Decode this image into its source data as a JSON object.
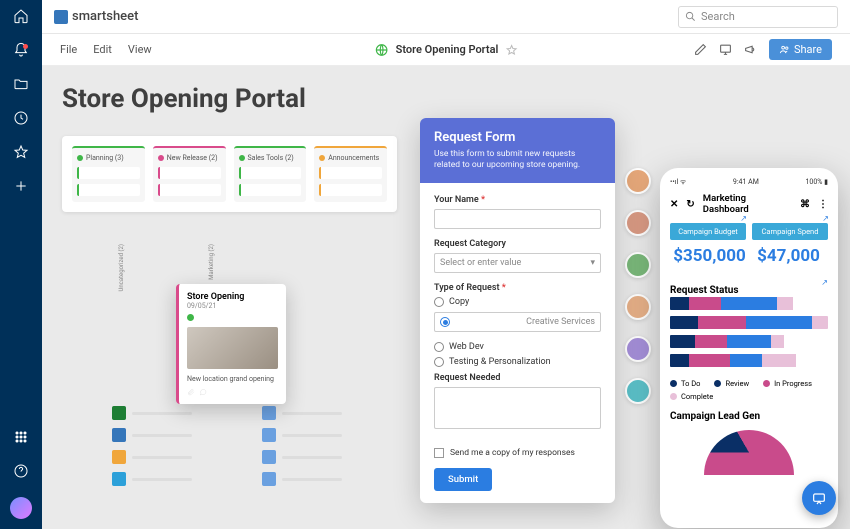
{
  "brand": "smartsheet",
  "search": {
    "placeholder": "Search"
  },
  "menu": {
    "file": "File",
    "edit": "Edit",
    "view": "View"
  },
  "page": {
    "title": "Store Opening Portal",
    "share": "Share"
  },
  "h1": "Store Opening Portal",
  "kanban": [
    {
      "label": "Planning (3)",
      "dot": "#3fb648",
      "bar": "#3fb648"
    },
    {
      "label": "New Release (2)",
      "dot": "#d94b8b",
      "bar": "#d94b8b"
    },
    {
      "label": "Sales Tools (2)",
      "dot": "#3fb648",
      "bar": "#3fb648"
    },
    {
      "label": "Announcements",
      "dot": "#f0a63b",
      "bar": "#f0a63b"
    }
  ],
  "swim_labels": {
    "left": "Uncategorized (2)",
    "right": "Marketing (2)"
  },
  "card": {
    "title": "Store Opening",
    "date": "09/05/21",
    "desc": "New location grand opening"
  },
  "files_left": [
    "#1e7e34",
    "#3576ba",
    "#f0a63b",
    "#2ca0d9"
  ],
  "files_right": [
    "#6aa0e0",
    "#6aa0e0",
    "#6aa0e0",
    "#6aa0e0"
  ],
  "form": {
    "title": "Request Form",
    "sub": "Use this form to submit new requests related to our upcoming store opening.",
    "name": "Your Name",
    "cat": "Request Category",
    "cat_ph": "Select or enter value",
    "type": "Type of Request",
    "opts": [
      "Copy",
      "Creative Services",
      "Web Dev",
      "Testing & Personalization"
    ],
    "opt_sel": 1,
    "needed": "Request Needed",
    "chk": "Send me a copy of my responses",
    "submit": "Submit"
  },
  "people": [
    "#e6a87a",
    "#d99a84",
    "#7ab87a",
    "#e6b088",
    "#a58fd9",
    "#5cc1c9"
  ],
  "phone": {
    "time": "9:41 AM",
    "batt": "100%",
    "title": "Marketing Dashboard",
    "chip1": "Campaign Budget",
    "chip2": "Campaign Spend",
    "m1": "$350,000",
    "m2": "$47,000",
    "sec1": "Request Status",
    "legend": [
      {
        "l": "To Do",
        "c": "#0a2f66"
      },
      {
        "l": "Review",
        "c": "#0a2f66"
      },
      {
        "l": "In Progress",
        "c": "#c94b8b"
      },
      {
        "l": "Complete",
        "c": "#e8c0d9"
      }
    ],
    "sec2": "Campaign Lead Gen"
  },
  "chart_data": {
    "type": "bar",
    "orientation": "horizontal",
    "stacked": true,
    "title": "Request Status",
    "xlabel": "",
    "ylabel": "",
    "series_colors": {
      "To Do": "#0a2f66",
      "In Progress": "#c94b8b",
      "Review": "#2b7de1",
      "Complete": "#e8c0d9"
    },
    "rows": [
      {
        "To Do": 12,
        "In Progress": 20,
        "Review": 36,
        "Complete": 10
      },
      {
        "To Do": 18,
        "In Progress": 30,
        "Review": 42,
        "Complete": 10
      },
      {
        "To Do": 16,
        "In Progress": 20,
        "Review": 28,
        "Complete": 8
      },
      {
        "To Do": 12,
        "In Progress": 26,
        "Review": 20,
        "Complete": 22
      }
    ],
    "xlim": [
      0,
      100
    ]
  }
}
